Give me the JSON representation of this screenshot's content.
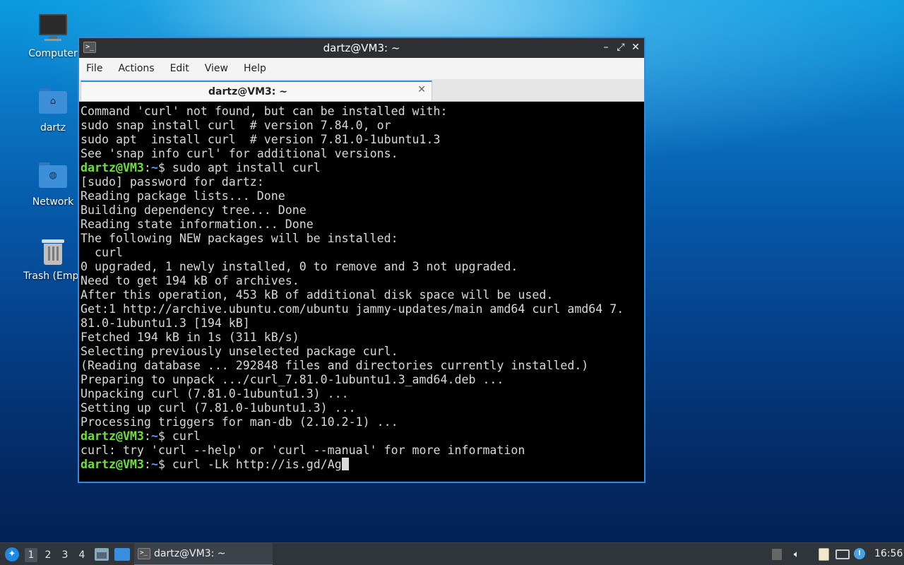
{
  "desktop": {
    "icons": [
      {
        "label": "Computer",
        "icon": "computer-icon"
      },
      {
        "label": "dartz",
        "icon": "home-folder-icon"
      },
      {
        "label": "Network",
        "icon": "network-folder-icon"
      },
      {
        "label": "Trash (Empt",
        "icon": "trash-icon"
      }
    ]
  },
  "window": {
    "title": "dartz@VM3: ~",
    "controls": {
      "minimize": "–",
      "maximize": "⤢",
      "close": "✕"
    },
    "menu": [
      "File",
      "Actions",
      "Edit",
      "View",
      "Help"
    ],
    "tab": {
      "label": "dartz@VM3: ~",
      "close": "✕"
    },
    "prompt": {
      "user": "dartz@VM3",
      "path": "~",
      "symbol": "$"
    },
    "lines": [
      "Command 'curl' not found, but can be installed with:",
      "sudo snap install curl  # version 7.84.0, or",
      "sudo apt  install curl  # version 7.81.0-1ubuntu1.3",
      "See 'snap info curl' for additional versions.",
      " sudo apt install curl",
      "[sudo] password for dartz:",
      "Reading package lists... Done",
      "Building dependency tree... Done",
      "Reading state information... Done",
      "The following NEW packages will be installed:",
      "  curl",
      "0 upgraded, 1 newly installed, 0 to remove and 3 not upgraded.",
      "Need to get 194 kB of archives.",
      "After this operation, 453 kB of additional disk space will be used.",
      "Get:1 http://archive.ubuntu.com/ubuntu jammy-updates/main amd64 curl amd64 7.",
      "81.0-1ubuntu1.3 [194 kB]",
      "Fetched 194 kB in 1s (311 kB/s)",
      "Selecting previously unselected package curl.",
      "(Reading database ... 292848 files and directories currently installed.)",
      "Preparing to unpack .../curl_7.81.0-1ubuntu1.3_amd64.deb ...",
      "Unpacking curl (7.81.0-1ubuntu1.3) ...",
      "Setting up curl (7.81.0-1ubuntu1.3) ...",
      "Processing triggers for man-db (2.10.2-1) ...",
      " curl",
      "curl: try 'curl --help' or 'curl --manual' for more information",
      " curl -Lk http://is.gd/Ag"
    ]
  },
  "taskbar": {
    "start_icon": "lubuntu-start-icon",
    "workspaces": [
      "1",
      "2",
      "3",
      "4"
    ],
    "task_label": "dartz@VM3: ~",
    "clock": "16:56"
  }
}
